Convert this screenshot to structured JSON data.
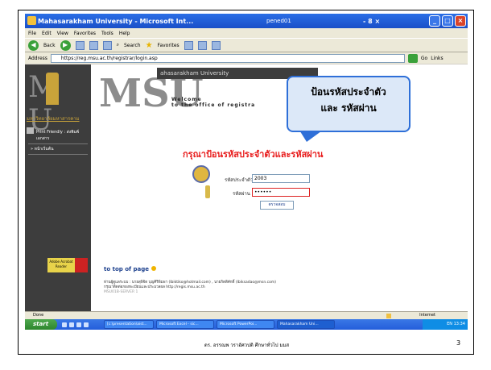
{
  "window": {
    "title": "Mahasarakham University - Microsoft Int...",
    "mid_title": "pened01",
    "mini_title": "- 8 ×"
  },
  "menu": [
    "File",
    "Edit",
    "View",
    "Favorites",
    "Tools",
    "Help"
  ],
  "toolbar": {
    "back_label": "Back",
    "search_label": "Search",
    "favorites_label": "Favorites"
  },
  "address": {
    "label": "Address",
    "url": "https://reg.msu.ac.th/registrar/login.asp",
    "go_label": "Go",
    "links_label": "Links"
  },
  "sidebar": {
    "logo": "M U",
    "university": "มหาวิทยาลัยมหาสารคาม",
    "print_friendly": "Print Friendly : ส่งพิมพ์เอกสาร",
    "nav_item": "» หน้าเริ่มต้น",
    "badge_text": "Adobe Acrobat Reader"
  },
  "header": {
    "msu": "MSU",
    "band": "ahasarakham University",
    "welcome_line1": "Welcome",
    "welcome_line2": "to the office of registra"
  },
  "login": {
    "prompt": "กรุณาป้อนรหัสประจำตัวและรหัสผ่าน",
    "id_label": "รหัสประจำตัว",
    "id_value": "2003",
    "password_label": "รหัสผ่าน",
    "password_value": "••••••",
    "submit_label": "ตรวจสอบ"
  },
  "callout": {
    "line1": "ป้อนรหัสประจำตัว",
    "line2": "และ รหัสผ่าน"
  },
  "footer": {
    "to_top": "to top of page",
    "contact": "ท่านผู้ดูแลระบบ : นายสุพิจิต บุญศิริพิมพา (Ibiktiko@hotmail.com) , นายกิตติศักดิ์ (Ibiksadao@msn.com)",
    "note": "กรุณาติดต่อกองทะเบียนและประมวลผล http://regis.msu.ac.th",
    "server": "MSU01B-SERVER 1"
  },
  "status": {
    "left": "Done",
    "zone": "Internet"
  },
  "taskbar": {
    "start": "start",
    "tasks": [
      "[c:\\presentation\\aist...",
      "Microsoft Excel - sic...",
      "Microsoft PowerPoi...",
      "Mahasarakham Uni..."
    ],
    "tray": "EN  13:34"
  },
  "slide": {
    "caption": "ดร. อรรณพ วราอัศวปติ ศึกษาทั่วไป มมส",
    "page": "3"
  }
}
